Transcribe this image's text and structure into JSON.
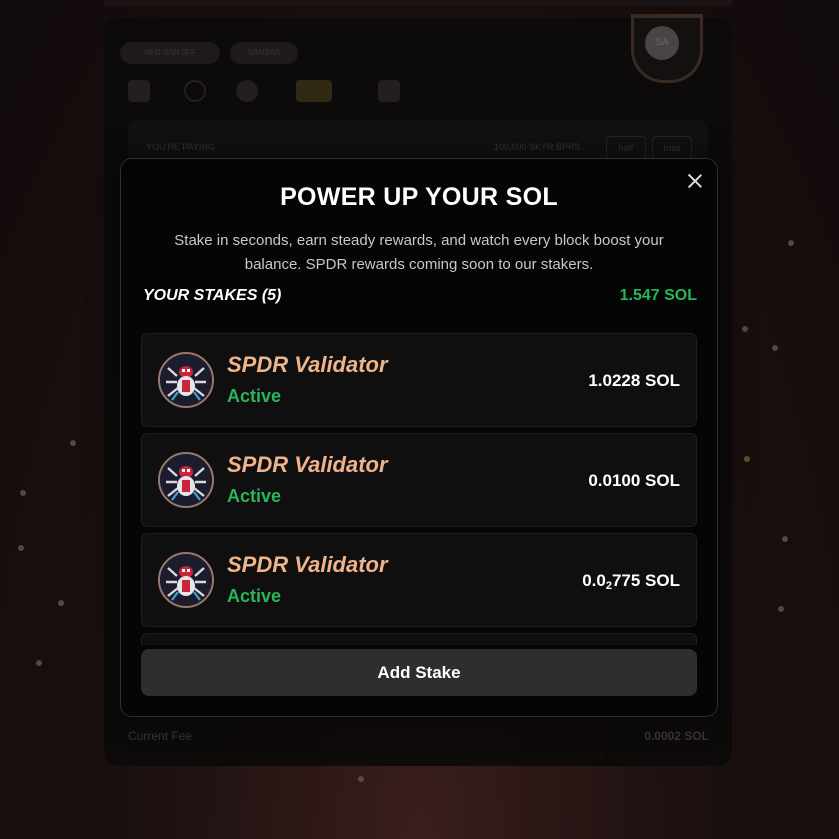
{
  "background": {
    "under_tags": [
      "NFD SAN 0FF",
      "SANSAS"
    ],
    "under_panel_label": "YOU'RE PAYING",
    "under_panel_right": "100,000 SKYR BPRS",
    "under_panel_buttons": [
      "half",
      "max"
    ],
    "under_bottom_left": "Current Fee",
    "under_bottom_right": "0.0002 SOL",
    "shield_label": "SA"
  },
  "modal": {
    "title": "POWER UP YOUR SOL",
    "description": "Stake in seconds, earn steady rewards, and watch every block boost your balance. SPDR rewards coming soon to our stakers.",
    "stakes_heading": "YOUR STAKES (5)",
    "stakes_total": "1.547 SOL",
    "add_button": "Add Stake"
  },
  "stakes": [
    {
      "name": "SPDR Validator",
      "status": "Active",
      "amount": "1.0228 SOL"
    },
    {
      "name": "SPDR Validator",
      "status": "Active",
      "amount": "0.0100 SOL"
    },
    {
      "name": "SPDR Validator",
      "status": "Active",
      "amount_prefix": "0.0",
      "amount_sub": "2",
      "amount_suffix": "775 SOL"
    }
  ],
  "colors": {
    "accent_green": "#29b55a",
    "validator_name": "#f0b48a",
    "button_bg": "#2e2e2e"
  },
  "icons": {
    "close": "close-icon",
    "avatar": "spider-avatar-icon"
  }
}
